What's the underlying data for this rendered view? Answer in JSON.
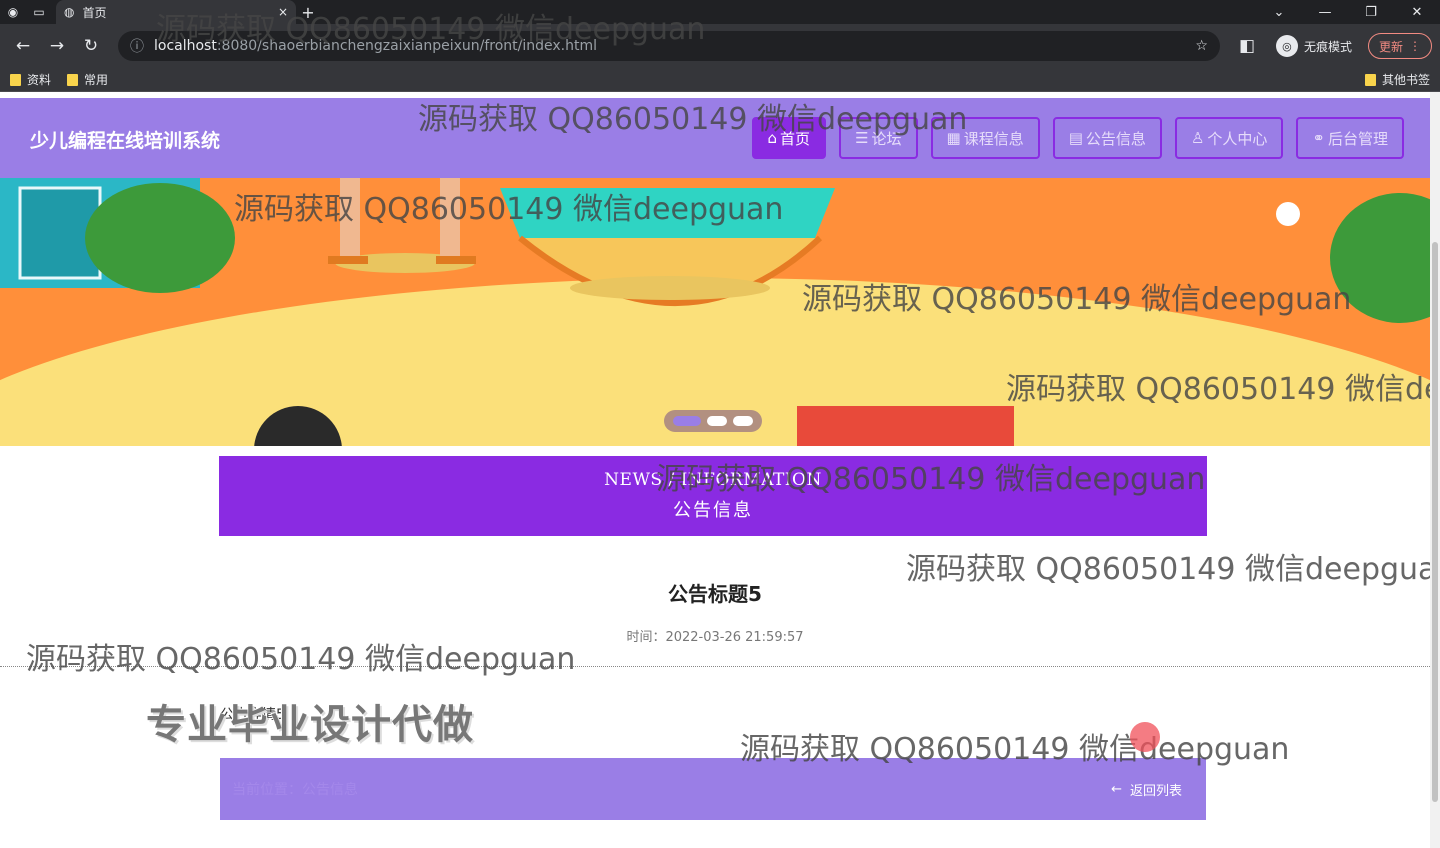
{
  "browser": {
    "tab_title": "首页",
    "tab_close": "×",
    "new_tab": "+",
    "url_host": "localhost",
    "url_path": ":8080/shaoerbianchengzaixianpeixun/front/index.html",
    "incognito_label": "无痕模式",
    "update_label": "更新",
    "bookmarks": [
      "资料",
      "常用"
    ],
    "other_bookmarks": "其他书签"
  },
  "site": {
    "title": "少儿编程在线培训系统",
    "nav": [
      {
        "label": "首页",
        "icon": "home-icon",
        "glyph": "⌂",
        "active": true
      },
      {
        "label": "论坛",
        "icon": "forum-icon",
        "glyph": "☰",
        "active": false
      },
      {
        "label": "课程信息",
        "icon": "course-icon",
        "glyph": "▦",
        "active": false
      },
      {
        "label": "公告信息",
        "icon": "notice-icon",
        "glyph": "▤",
        "active": false
      },
      {
        "label": "个人中心",
        "icon": "user-icon",
        "glyph": "♙",
        "active": false
      },
      {
        "label": "后台管理",
        "icon": "link-icon",
        "glyph": "⚭",
        "active": false
      }
    ]
  },
  "news": {
    "en": "NEWS / INFORMATION",
    "zh": "公告信息"
  },
  "notice": {
    "title": "公告标题5",
    "time": "时间：2022-03-26 21:59:57",
    "content": "公告详情5"
  },
  "footer": {
    "breadcrumb": "当前位置：公告信息",
    "back_label": "返回列表"
  },
  "watermark": {
    "text": "源码获取 QQ86050149 微信deepguan",
    "big_text": "专业毕业设计代做"
  },
  "colors": {
    "accent": "#8a2be2",
    "header": "#9a7ee6"
  }
}
